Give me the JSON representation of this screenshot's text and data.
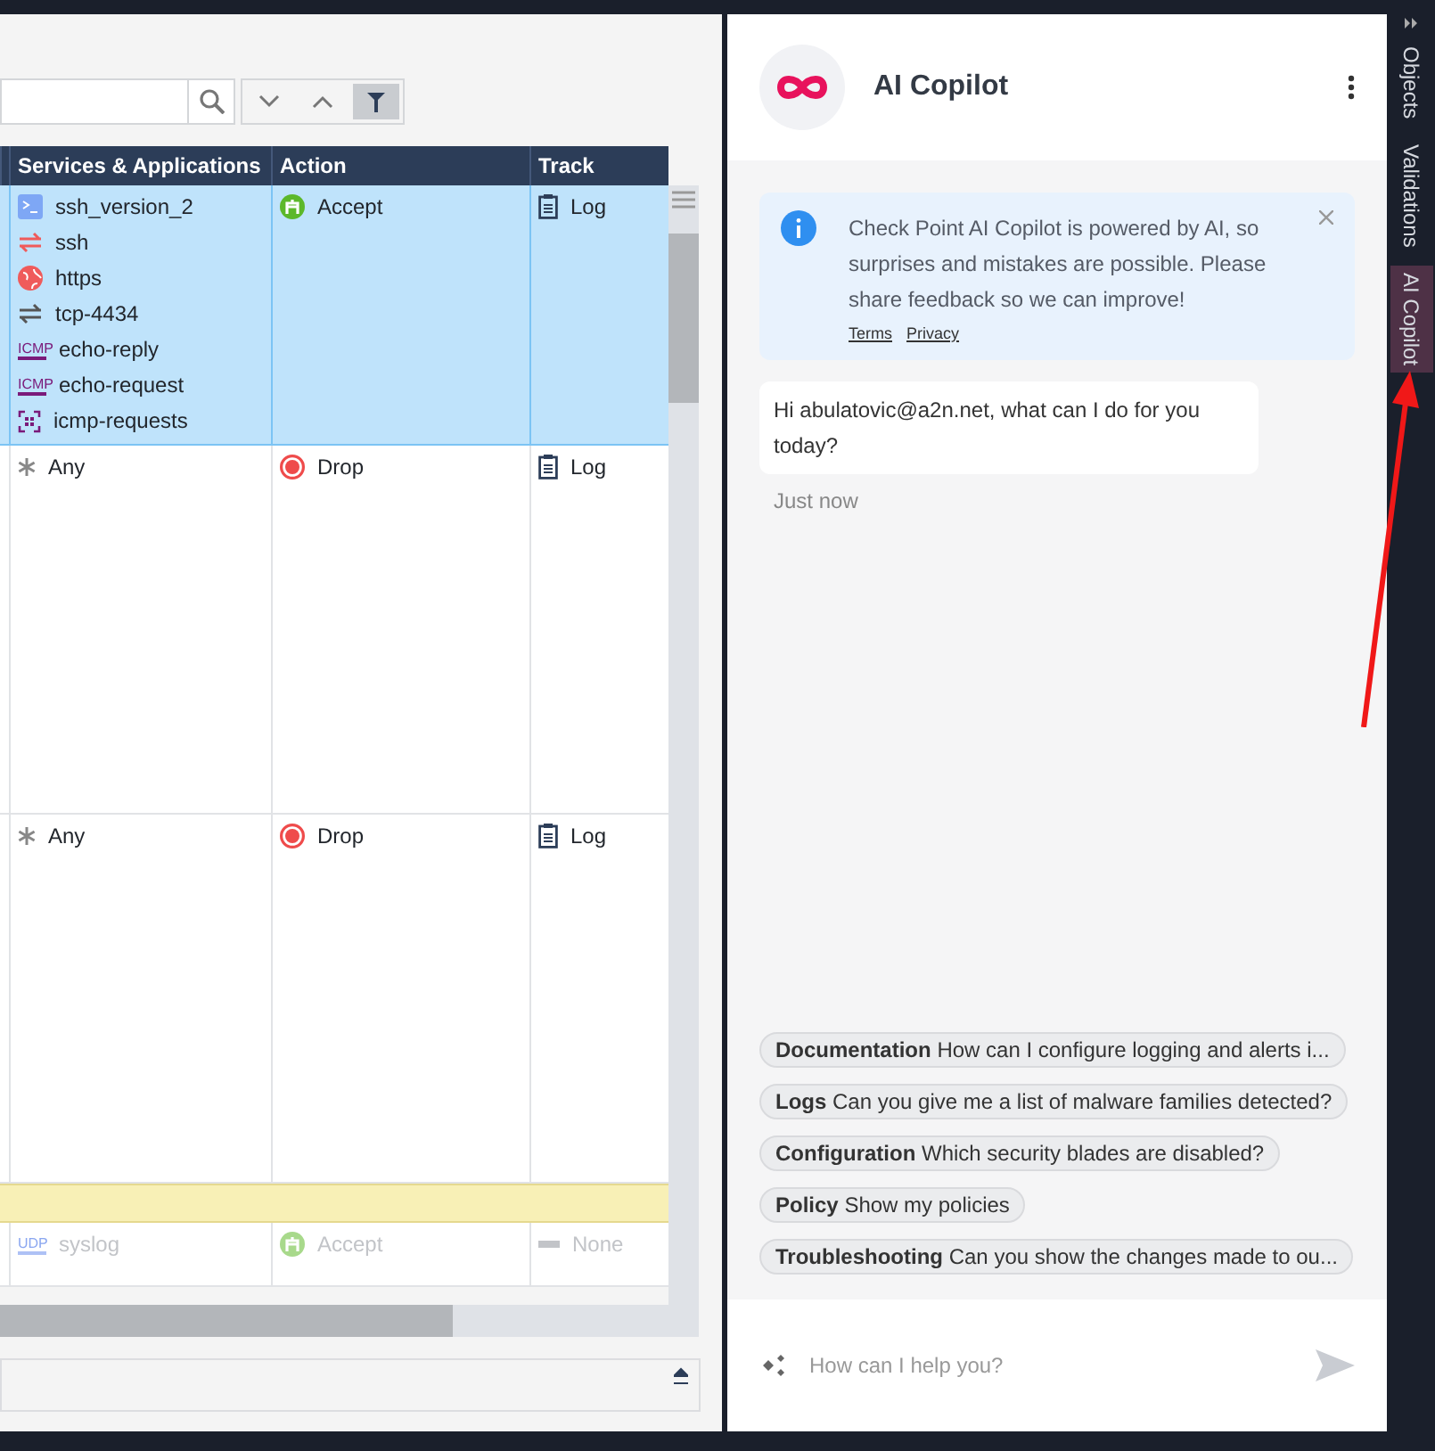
{
  "rule_table": {
    "columns": [
      "Services & Applications",
      "Action",
      "Track"
    ],
    "rows": [
      {
        "kind": "rule",
        "selected": true,
        "disabled": false,
        "services": [
          {
            "kind": "terminal",
            "name": "ssh_version_2"
          },
          {
            "kind": "tcp",
            "name": "ssh"
          },
          {
            "kind": "web",
            "name": "https"
          },
          {
            "kind": "port",
            "name": "tcp-4434"
          },
          {
            "kind": "icmp",
            "badge": "ICMP",
            "name": "echo-reply"
          },
          {
            "kind": "icmp",
            "badge": "ICMP",
            "name": "echo-request"
          },
          {
            "kind": "group",
            "name": "icmp-requests"
          }
        ],
        "action": {
          "kind": "accept",
          "label": "Accept"
        },
        "track": {
          "kind": "log",
          "label": "Log"
        }
      },
      {
        "kind": "rule",
        "selected": false,
        "disabled": false,
        "services": [
          {
            "kind": "any",
            "name": "Any"
          }
        ],
        "action": {
          "kind": "drop",
          "label": "Drop"
        },
        "track": {
          "kind": "log",
          "label": "Log"
        }
      },
      {
        "kind": "rule",
        "selected": false,
        "disabled": false,
        "services": [
          {
            "kind": "any",
            "name": "Any"
          }
        ],
        "action": {
          "kind": "drop",
          "label": "Drop"
        },
        "track": {
          "kind": "log",
          "label": "Log"
        }
      },
      {
        "kind": "section"
      },
      {
        "kind": "rule",
        "selected": false,
        "disabled": true,
        "services": [
          {
            "kind": "udp",
            "badge": "UDP",
            "name": "syslog"
          }
        ],
        "action": {
          "kind": "accept",
          "label": "Accept"
        },
        "track": {
          "kind": "none",
          "label": "None"
        }
      }
    ]
  },
  "copilot": {
    "title": "AI Copilot",
    "notice": {
      "text": "Check Point AI Copilot is powered by AI, so surprises and mistakes are possible. Please share feedback so we can improve!",
      "links": [
        "Terms",
        "Privacy"
      ]
    },
    "messages": [
      {
        "text": "Hi abulatovic@a2n.net, what can I do for you today?",
        "time": "Just now"
      }
    ],
    "suggestions": [
      {
        "category": "Documentation",
        "text": "How can I configure logging and alerts i..."
      },
      {
        "category": "Logs",
        "text": "Can you give me a list of malware families detected?"
      },
      {
        "category": "Configuration",
        "text": "Which security blades are disabled?"
      },
      {
        "category": "Policy",
        "text": "Show my policies"
      },
      {
        "category": "Troubleshooting",
        "text": "Can you show the changes made to ou..."
      }
    ],
    "input": {
      "placeholder": "How can I help you?"
    }
  },
  "side_tabs": [
    {
      "label": "Objects",
      "selected": false
    },
    {
      "label": "Validations",
      "selected": false
    },
    {
      "label": "AI Copilot",
      "selected": true
    }
  ]
}
